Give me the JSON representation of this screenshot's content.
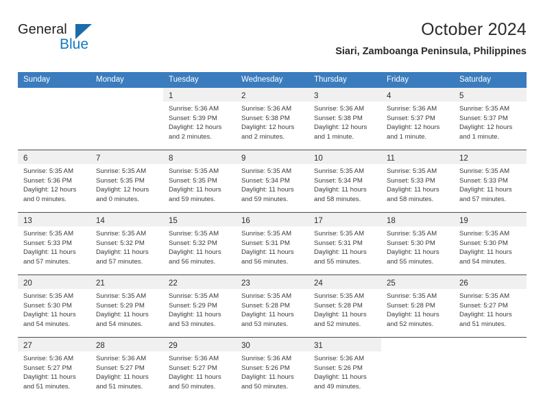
{
  "logo": {
    "word_one": "General",
    "word_two": "Blue",
    "triangle_icon": "blue-triangle-icon",
    "accent_color": "#1b6cab"
  },
  "header": {
    "title": "October 2024",
    "subtitle": "Siari, Zamboanga Peninsula, Philippines",
    "header_bg_color": "#3a7cbe",
    "daynum_band_color": "#f0f0f0"
  },
  "weekdays": [
    "Sunday",
    "Monday",
    "Tuesday",
    "Wednesday",
    "Thursday",
    "Friday",
    "Saturday"
  ],
  "weeks": [
    [
      {
        "day": "",
        "lines": []
      },
      {
        "day": "",
        "lines": []
      },
      {
        "day": "1",
        "lines": [
          "Sunrise: 5:36 AM",
          "Sunset: 5:39 PM",
          "Daylight: 12 hours",
          "and 2 minutes."
        ]
      },
      {
        "day": "2",
        "lines": [
          "Sunrise: 5:36 AM",
          "Sunset: 5:38 PM",
          "Daylight: 12 hours",
          "and 2 minutes."
        ]
      },
      {
        "day": "3",
        "lines": [
          "Sunrise: 5:36 AM",
          "Sunset: 5:38 PM",
          "Daylight: 12 hours",
          "and 1 minute."
        ]
      },
      {
        "day": "4",
        "lines": [
          "Sunrise: 5:36 AM",
          "Sunset: 5:37 PM",
          "Daylight: 12 hours",
          "and 1 minute."
        ]
      },
      {
        "day": "5",
        "lines": [
          "Sunrise: 5:35 AM",
          "Sunset: 5:37 PM",
          "Daylight: 12 hours",
          "and 1 minute."
        ]
      }
    ],
    [
      {
        "day": "6",
        "lines": [
          "Sunrise: 5:35 AM",
          "Sunset: 5:36 PM",
          "Daylight: 12 hours",
          "and 0 minutes."
        ]
      },
      {
        "day": "7",
        "lines": [
          "Sunrise: 5:35 AM",
          "Sunset: 5:35 PM",
          "Daylight: 12 hours",
          "and 0 minutes."
        ]
      },
      {
        "day": "8",
        "lines": [
          "Sunrise: 5:35 AM",
          "Sunset: 5:35 PM",
          "Daylight: 11 hours",
          "and 59 minutes."
        ]
      },
      {
        "day": "9",
        "lines": [
          "Sunrise: 5:35 AM",
          "Sunset: 5:34 PM",
          "Daylight: 11 hours",
          "and 59 minutes."
        ]
      },
      {
        "day": "10",
        "lines": [
          "Sunrise: 5:35 AM",
          "Sunset: 5:34 PM",
          "Daylight: 11 hours",
          "and 58 minutes."
        ]
      },
      {
        "day": "11",
        "lines": [
          "Sunrise: 5:35 AM",
          "Sunset: 5:33 PM",
          "Daylight: 11 hours",
          "and 58 minutes."
        ]
      },
      {
        "day": "12",
        "lines": [
          "Sunrise: 5:35 AM",
          "Sunset: 5:33 PM",
          "Daylight: 11 hours",
          "and 57 minutes."
        ]
      }
    ],
    [
      {
        "day": "13",
        "lines": [
          "Sunrise: 5:35 AM",
          "Sunset: 5:33 PM",
          "Daylight: 11 hours",
          "and 57 minutes."
        ]
      },
      {
        "day": "14",
        "lines": [
          "Sunrise: 5:35 AM",
          "Sunset: 5:32 PM",
          "Daylight: 11 hours",
          "and 57 minutes."
        ]
      },
      {
        "day": "15",
        "lines": [
          "Sunrise: 5:35 AM",
          "Sunset: 5:32 PM",
          "Daylight: 11 hours",
          "and 56 minutes."
        ]
      },
      {
        "day": "16",
        "lines": [
          "Sunrise: 5:35 AM",
          "Sunset: 5:31 PM",
          "Daylight: 11 hours",
          "and 56 minutes."
        ]
      },
      {
        "day": "17",
        "lines": [
          "Sunrise: 5:35 AM",
          "Sunset: 5:31 PM",
          "Daylight: 11 hours",
          "and 55 minutes."
        ]
      },
      {
        "day": "18",
        "lines": [
          "Sunrise: 5:35 AM",
          "Sunset: 5:30 PM",
          "Daylight: 11 hours",
          "and 55 minutes."
        ]
      },
      {
        "day": "19",
        "lines": [
          "Sunrise: 5:35 AM",
          "Sunset: 5:30 PM",
          "Daylight: 11 hours",
          "and 54 minutes."
        ]
      }
    ],
    [
      {
        "day": "20",
        "lines": [
          "Sunrise: 5:35 AM",
          "Sunset: 5:30 PM",
          "Daylight: 11 hours",
          "and 54 minutes."
        ]
      },
      {
        "day": "21",
        "lines": [
          "Sunrise: 5:35 AM",
          "Sunset: 5:29 PM",
          "Daylight: 11 hours",
          "and 54 minutes."
        ]
      },
      {
        "day": "22",
        "lines": [
          "Sunrise: 5:35 AM",
          "Sunset: 5:29 PM",
          "Daylight: 11 hours",
          "and 53 minutes."
        ]
      },
      {
        "day": "23",
        "lines": [
          "Sunrise: 5:35 AM",
          "Sunset: 5:28 PM",
          "Daylight: 11 hours",
          "and 53 minutes."
        ]
      },
      {
        "day": "24",
        "lines": [
          "Sunrise: 5:35 AM",
          "Sunset: 5:28 PM",
          "Daylight: 11 hours",
          "and 52 minutes."
        ]
      },
      {
        "day": "25",
        "lines": [
          "Sunrise: 5:35 AM",
          "Sunset: 5:28 PM",
          "Daylight: 11 hours",
          "and 52 minutes."
        ]
      },
      {
        "day": "26",
        "lines": [
          "Sunrise: 5:35 AM",
          "Sunset: 5:27 PM",
          "Daylight: 11 hours",
          "and 51 minutes."
        ]
      }
    ],
    [
      {
        "day": "27",
        "lines": [
          "Sunrise: 5:36 AM",
          "Sunset: 5:27 PM",
          "Daylight: 11 hours",
          "and 51 minutes."
        ]
      },
      {
        "day": "28",
        "lines": [
          "Sunrise: 5:36 AM",
          "Sunset: 5:27 PM",
          "Daylight: 11 hours",
          "and 51 minutes."
        ]
      },
      {
        "day": "29",
        "lines": [
          "Sunrise: 5:36 AM",
          "Sunset: 5:27 PM",
          "Daylight: 11 hours",
          "and 50 minutes."
        ]
      },
      {
        "day": "30",
        "lines": [
          "Sunrise: 5:36 AM",
          "Sunset: 5:26 PM",
          "Daylight: 11 hours",
          "and 50 minutes."
        ]
      },
      {
        "day": "31",
        "lines": [
          "Sunrise: 5:36 AM",
          "Sunset: 5:26 PM",
          "Daylight: 11 hours",
          "and 49 minutes."
        ]
      },
      {
        "day": "",
        "lines": []
      },
      {
        "day": "",
        "lines": []
      }
    ]
  ]
}
